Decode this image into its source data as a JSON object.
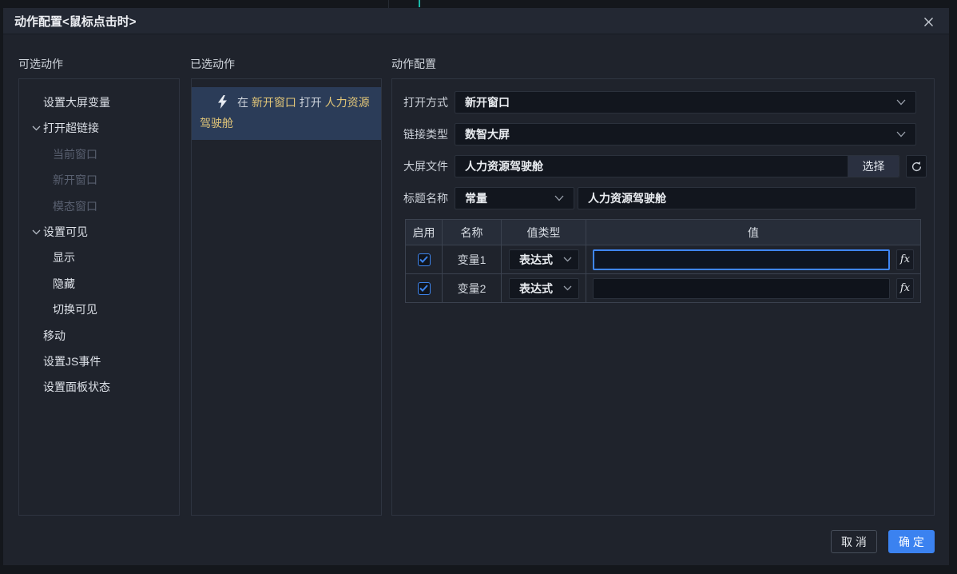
{
  "dialog": {
    "title": "动作配置<鼠标点击时>"
  },
  "panels": {
    "available": {
      "header": "可选动作",
      "tree": [
        {
          "label": "设置大屏变量"
        },
        {
          "label": "打开超链接"
        },
        {
          "label": "当前窗口"
        },
        {
          "label": "新开窗口"
        },
        {
          "label": "模态窗口"
        },
        {
          "label": "设置可见"
        },
        {
          "label": "显示"
        },
        {
          "label": "隐藏"
        },
        {
          "label": "切换可见"
        },
        {
          "label": "移动"
        },
        {
          "label": "设置JS事件"
        },
        {
          "label": "设置面板状态"
        }
      ]
    },
    "selected": {
      "header": "已选动作",
      "item": {
        "prefix": "在",
        "target": "新开窗口",
        "middle": "打开",
        "name": "人力资源驾驶舱"
      }
    },
    "config": {
      "header": "动作配置",
      "fields": {
        "open_mode": {
          "label": "打开方式",
          "value": "新开窗口"
        },
        "link_type": {
          "label": "链接类型",
          "value": "数智大屏"
        },
        "screen_file": {
          "label": "大屏文件",
          "value": "人力资源驾驶舱",
          "select_button": "选择"
        },
        "title_name": {
          "label": "标题名称",
          "type_value": "常量",
          "value": "人力资源驾驶舱"
        }
      },
      "table": {
        "headers": {
          "enable": "启用",
          "name": "名称",
          "value_type": "值类型",
          "value": "值"
        },
        "fx_label": "fx",
        "rows": [
          {
            "enabled": true,
            "name": "变量1",
            "value_type": "表达式",
            "value": ""
          },
          {
            "enabled": true,
            "name": "变量2",
            "value_type": "表达式",
            "value": ""
          }
        ]
      }
    }
  },
  "footer": {
    "cancel": "取 消",
    "confirm": "确 定"
  },
  "colors": {
    "accent_blue": "#3b82f0",
    "focus_border": "#3f86f5",
    "checkbox_blue": "#3d84ec",
    "gold_text": "#e2c678",
    "selected_item_bg": "#2b3c58",
    "modal_bg": "#1f232c",
    "titlebar_bg": "#232833",
    "page_bg": "#14171c"
  }
}
